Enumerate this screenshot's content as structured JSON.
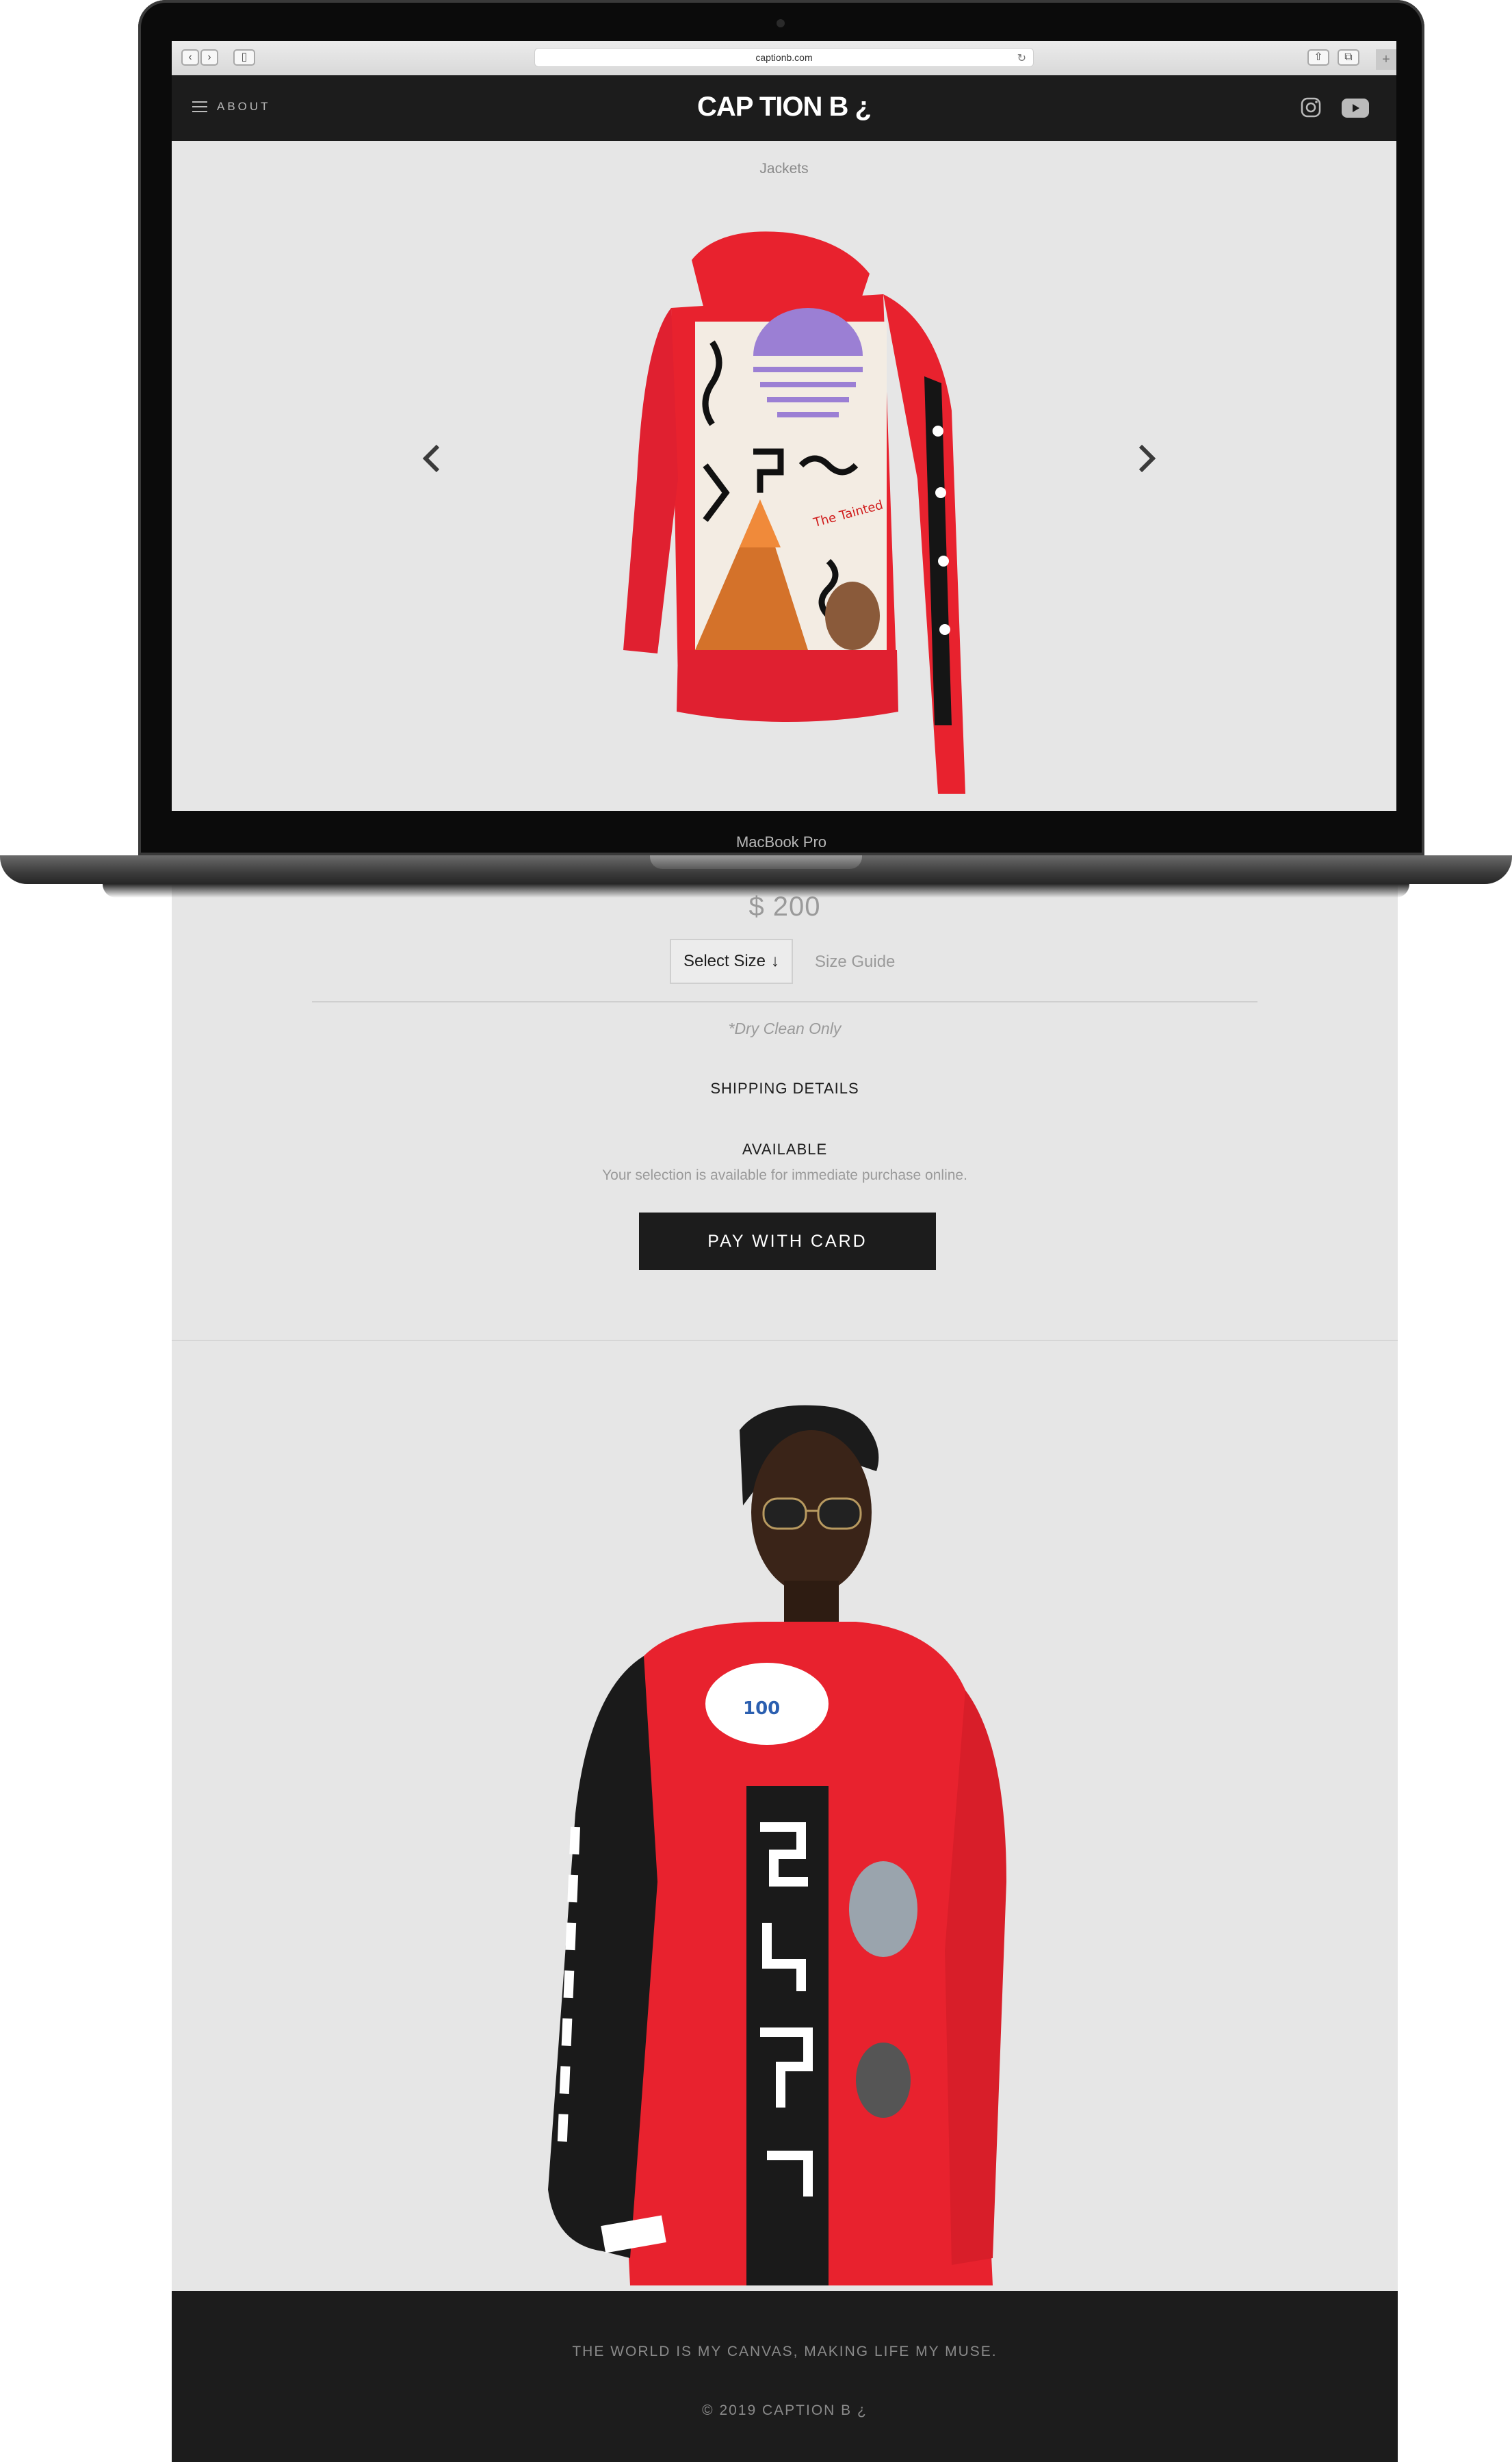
{
  "browser": {
    "url": "captionb.com"
  },
  "header": {
    "menu_label": "ABOUT",
    "logo": "CAP TION B ¿"
  },
  "product": {
    "category": "Jackets",
    "price": "$ 200",
    "select_size_label": "Select Size",
    "select_size_arrow": "↓",
    "size_guide_label": "Size Guide",
    "care_note": "*Dry Clean Only",
    "shipping_label": "SHIPPING DETAILS",
    "availability_title": "AVAILABLE",
    "availability_text": "Your selection is available for immediate purchase online.",
    "pay_button": "PAY WITH CARD"
  },
  "laptop": {
    "model_label": "MacBook Pro"
  },
  "footer": {
    "tagline": "THE WORLD IS MY CANVAS, MAKING LIFE MY MUSE.",
    "copyright": "© 2019 CAPTION B ¿"
  },
  "icons": {
    "menu": "hamburger-icon",
    "instagram": "instagram-icon",
    "youtube": "youtube-icon",
    "prev": "chevron-left-icon",
    "next": "chevron-right-icon"
  },
  "colors": {
    "page_bg": "#e6e6e6",
    "header_bg": "#1c1c1c",
    "jacket_red": "#e8222e",
    "button_bg": "#1c1c1c"
  }
}
